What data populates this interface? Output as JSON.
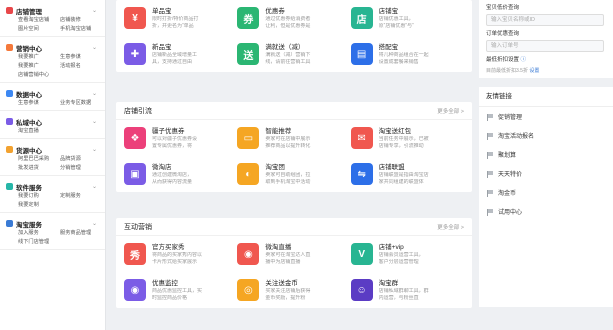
{
  "sidebar": {
    "groups": [
      {
        "title": "店铺管理",
        "color": "#e8474a",
        "links": [
          "查看淘宝店铺",
          "店铺装修",
          "图片空间",
          "手机淘宝店铺"
        ]
      },
      {
        "title": "营销中心",
        "color": "#f5793b",
        "links": [
          "我要推广",
          "生意参谋",
          "我要推广",
          "活动报名",
          "店铺营销中心"
        ]
      },
      {
        "title": "数据中心",
        "color": "#3d88f2",
        "links": [
          "生意参谋",
          "业务专区数据"
        ]
      },
      {
        "title": "私域中心",
        "color": "#7b5ce6",
        "links": [
          "淘宝直播"
        ]
      },
      {
        "title": "货源中心",
        "color": "#f2a230",
        "links": [
          "阿里巴巴采购",
          "品牌货源",
          "批发进货",
          "分销管理"
        ]
      },
      {
        "title": "软件服务",
        "color": "#26b6a8",
        "links": [
          "我要订购",
          "定制服务",
          "我要定制"
        ]
      },
      {
        "title": "淘宝服务",
        "color": "#3a7bd5",
        "links": [
          "加入服务",
          "服务商品管理",
          "线下门店管理"
        ]
      }
    ]
  },
  "panels": [
    {
      "title": "",
      "more": "",
      "apps": [
        {
          "name": "单品宝",
          "desc": [
            "限时打折/特价商品打",
            "折，并更名为“单品"
          ],
          "color": "#f0574f",
          "glyph": "¥",
          "icon": "coupon-icon"
        },
        {
          "name": "优惠券",
          "desc": [
            "通过优惠券给消费者",
            "让利，但是优惠券是"
          ],
          "color": "#2bb673",
          "glyph": "券",
          "icon": "ticket-icon"
        },
        {
          "name": "店铺宝",
          "desc": [
            "店铺优惠工具，",
            "原“店铺优惠”与“"
          ],
          "color": "#28b592",
          "glyph": "店",
          "icon": "shop-icon"
        },
        {
          "name": "新品宝",
          "desc": [
            "店铺新品全域增量工",
            "具，支持通过自由"
          ],
          "color": "#7b5ce6",
          "glyph": "✚",
          "icon": "puzzle-icon"
        },
        {
          "name": "满就送（减）",
          "desc": [
            "满就送（减）营销下",
            "线，请前往营销工具"
          ],
          "color": "#2bb673",
          "glyph": "送",
          "icon": "gift-icon"
        },
        {
          "name": "搭配宝",
          "desc": [
            "将几种商品组合在一起",
            "设置成套餐来销售"
          ],
          "color": "#2d6fe8",
          "glyph": "▤",
          "icon": "bundle-icon"
        }
      ]
    },
    {
      "title": "店铺引流",
      "more": "更多全部 >",
      "apps": [
        {
          "name": "疆子优惠券",
          "desc": [
            "可以对疆子优惠券设",
            "置专属优惠券，将"
          ],
          "color": "#ec407a",
          "glyph": "❖",
          "icon": "gem-icon"
        },
        {
          "name": "智能推荐",
          "desc": [
            "卖家可在店铺中展示",
            "推荐商品以提升转化"
          ],
          "color": "#f5a623",
          "glyph": "▭",
          "icon": "recommend-icon"
        },
        {
          "name": "淘宝送红包",
          "desc": [
            "当前任务中展示，已被",
            "店铺专享，引流推动"
          ],
          "color": "#f0574f",
          "glyph": "✉",
          "icon": "redpacket-icon"
        },
        {
          "name": "微淘店",
          "desc": [
            "通过创建微淘店，",
            "从而获得内容流量"
          ],
          "color": "#7b5ce6",
          "glyph": "▣",
          "icon": "photo-icon"
        },
        {
          "name": "淘宝团",
          "desc": [
            "卖家可自助组团，拉",
            "取到手机淘宝中活动"
          ],
          "color": "#f5a623",
          "glyph": "◐",
          "icon": "group-icon"
        },
        {
          "name": "店铺联盟",
          "desc": [
            "店铺联盟是指由淘宝店",
            "家共同组建的联盟体"
          ],
          "color": "#2d6fe8",
          "glyph": "⇋",
          "icon": "handshake-icon"
        }
      ]
    },
    {
      "title": "互动营销",
      "more": "更多全部 >",
      "apps": [
        {
          "name": "官方买家秀",
          "desc": [
            "将商品的买家秀内容以",
            "卡片形式给买家展示"
          ],
          "color": "#f0574f",
          "glyph": "秀",
          "icon": "showcase-icon"
        },
        {
          "name": "微淘直播",
          "desc": [
            "卖家可在淘宝达人直",
            "播中为店铺直播"
          ],
          "color": "#f0574f",
          "glyph": "◉",
          "icon": "broadcast-icon"
        },
        {
          "name": "店铺+vip",
          "desc": [
            "店铺会员运营工具，",
            "客户分层运营管理"
          ],
          "color": "#28b592",
          "glyph": "V",
          "icon": "vip-icon"
        },
        {
          "name": "优惠监控",
          "desc": [
            "商品优惠监控工具，实",
            "时监控商品价格"
          ],
          "color": "#7b5ce6",
          "glyph": "◉",
          "icon": "eye-icon"
        },
        {
          "name": "关注送金币",
          "desc": [
            "买家关注店铺后获得",
            "金币奖励，提升粉"
          ],
          "color": "#f5a623",
          "glyph": "◎",
          "icon": "follow-icon"
        },
        {
          "name": "淘宝群",
          "desc": [
            "店铺私域群聊工具，群",
            "内运营，与粉丝直"
          ],
          "color": "#5b3cc4",
          "glyph": "☺",
          "icon": "chat-icon"
        }
      ]
    }
  ],
  "right": {
    "query_label": "宝贝低价查询",
    "query_placeholder": "输入宝贝名称或ID",
    "order_label": "订单优惠查询",
    "order_placeholder": "输入订单号",
    "min_label": "最低折扣设置",
    "min_text": "目前最低折扣3.5折",
    "min_link": "设置",
    "links_title": "友情链接",
    "links": [
      "促销管理",
      "淘宝活动报名",
      "聚划算",
      "天天特价",
      "淘金币",
      "试用中心"
    ]
  }
}
